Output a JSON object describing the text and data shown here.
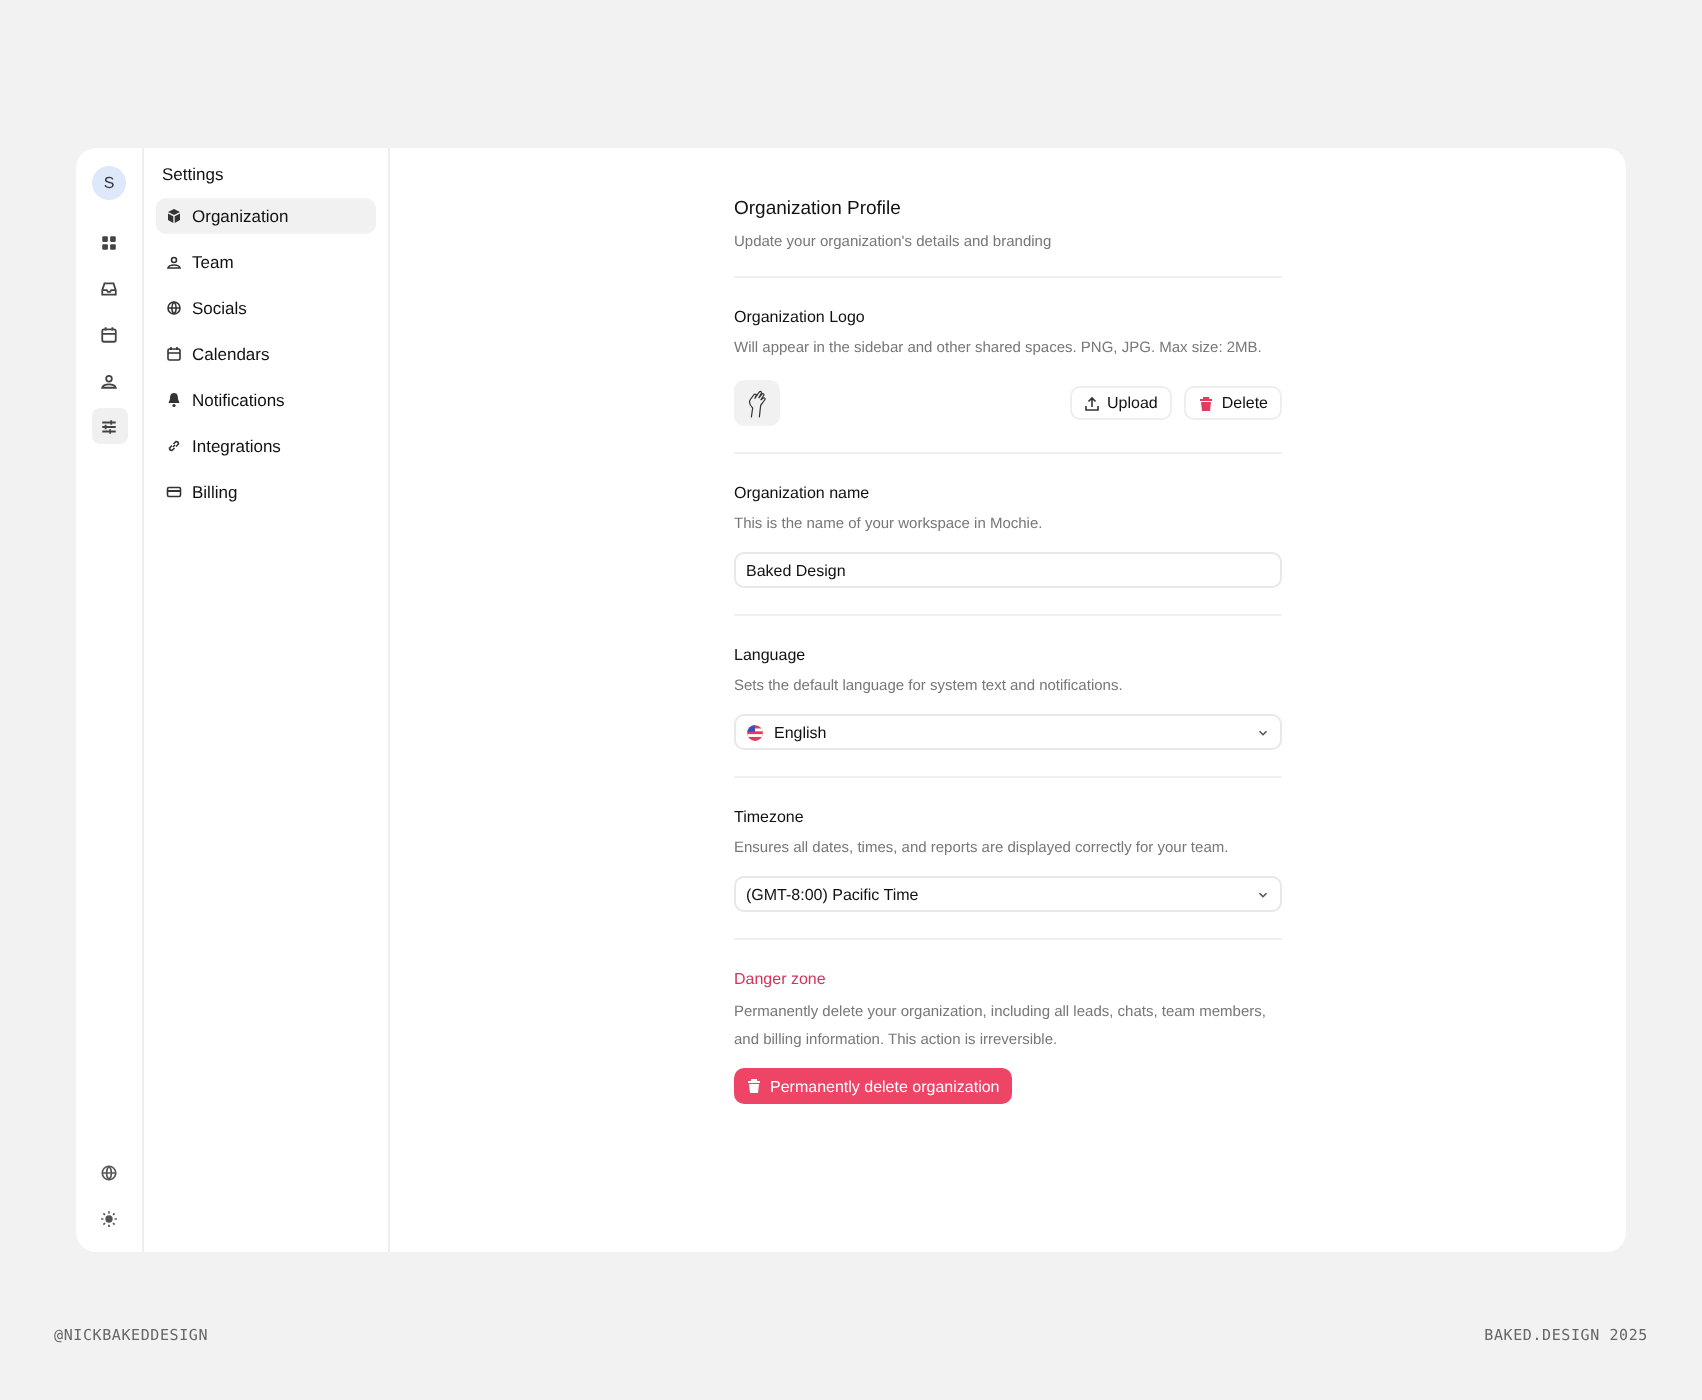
{
  "rail": {
    "avatar": "S",
    "items": [
      {
        "selected": false
      },
      {
        "selected": false
      },
      {
        "selected": false
      },
      {
        "selected": false
      },
      {
        "selected": true
      }
    ],
    "bottom": [
      {
        "selected": false
      },
      {
        "selected": false
      }
    ]
  },
  "settings": {
    "title": "Settings",
    "items": [
      {
        "label": "Organization",
        "selected": true
      },
      {
        "label": "Team",
        "selected": false
      },
      {
        "label": "Socials",
        "selected": false
      },
      {
        "label": "Calendars",
        "selected": false
      },
      {
        "label": "Notifications",
        "selected": false
      },
      {
        "label": "Integrations",
        "selected": false
      },
      {
        "label": "Billing",
        "selected": false
      }
    ]
  },
  "profile": {
    "title": "Organization Profile",
    "subtitle": "Update your organization's details and branding"
  },
  "logo": {
    "title": "Organization Logo",
    "description": "Will appear in the sidebar and other shared spaces. PNG, JPG. Max size: 2MB.",
    "upload": "Upload",
    "delete": "Delete"
  },
  "name": {
    "title": "Organization name",
    "description": "This is the name of your workspace in Mochie.",
    "value": "Baked Design"
  },
  "language": {
    "title": "Language",
    "description": "Sets the default language for system text and notifications.",
    "value": "English"
  },
  "timezone": {
    "title": "Timezone",
    "description": "Ensures all dates, times, and reports are displayed correctly for your team.",
    "value": "(GMT-8:00) Pacific Time"
  },
  "danger": {
    "title": "Danger zone",
    "description": "Permanently delete your organization, including all leads, chats, team members, and billing information. This action is irreversible.",
    "button": "Permanently delete organization"
  },
  "footer": {
    "left": "@NICKBAKEDDESIGN",
    "right": "BAKED.DESIGN 2025"
  }
}
